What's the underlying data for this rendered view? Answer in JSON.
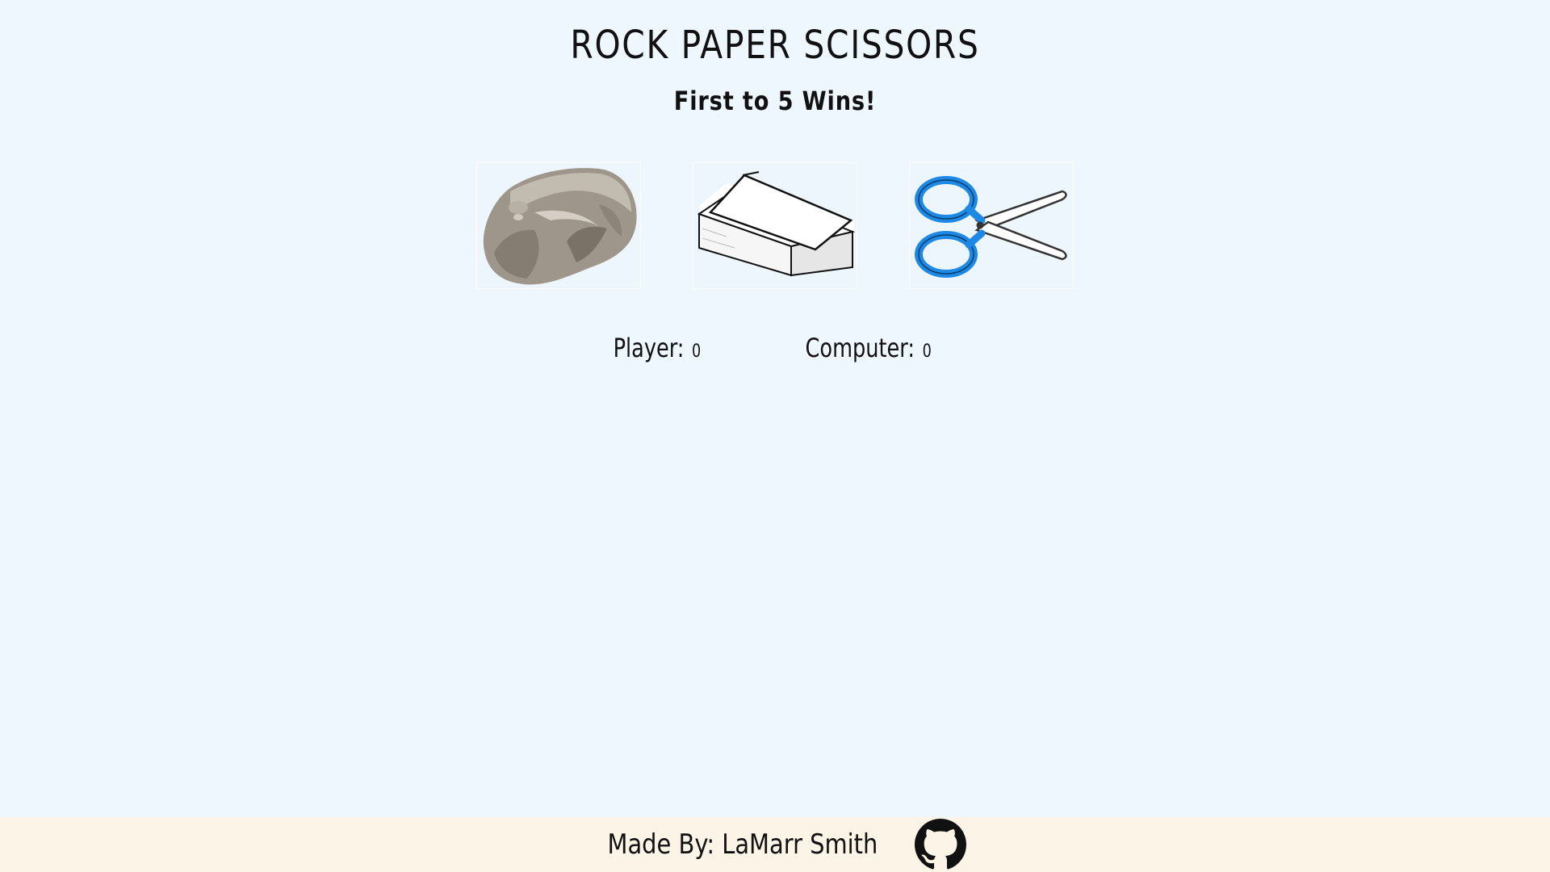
{
  "header": {
    "title": "ROCK PAPER SCISSORS",
    "subtitle": "First to 5 Wins!"
  },
  "choices": [
    {
      "label": "rock",
      "icon": "rock-icon"
    },
    {
      "label": "paper",
      "icon": "paper-icon"
    },
    {
      "label": "scissors",
      "icon": "scissors-icon"
    }
  ],
  "scoreboard": {
    "player_label": "Player:",
    "player_score": "0",
    "computer_label": "Computer:",
    "computer_score": "0"
  },
  "footer": {
    "made_by": "Made By: LaMarr Smith",
    "link_icon": "github-icon"
  },
  "colors": {
    "background": "#eff7fe",
    "footer_background": "#fcf5e7",
    "scissors_handle": "#1e88e5"
  }
}
